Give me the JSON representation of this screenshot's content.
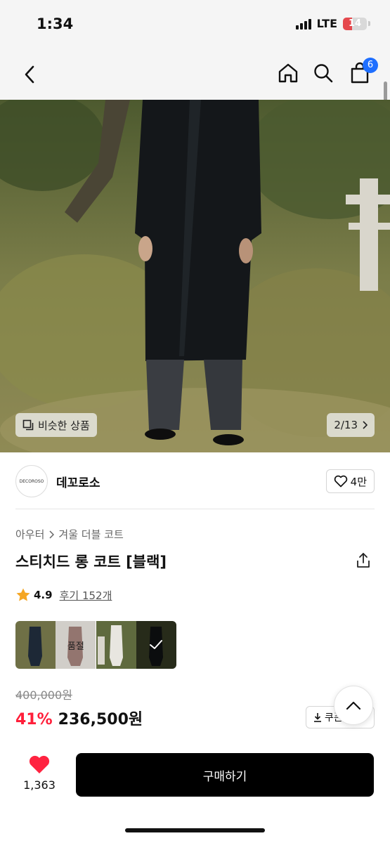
{
  "status_bar": {
    "time": "1:34",
    "network": "LTE",
    "battery": "14",
    "battery_level": 0.14
  },
  "nav": {
    "back_icon": "chevron-left-icon",
    "home_icon": "home-icon",
    "search_icon": "search-icon",
    "cart_icon": "shopping-bag-icon",
    "cart_badge": "6"
  },
  "hero": {
    "similar_label": "비슷한 상품",
    "page_indicator": "2/13"
  },
  "brand": {
    "logo_text": "DECOROSO",
    "name": "데꼬로소",
    "like_count": "4만"
  },
  "product": {
    "breadcrumb": [
      "아우터",
      "겨울 더블 코트"
    ],
    "title": "스티치드 롱 코트 [블랙]",
    "rating": "4.9",
    "reviews": "후기 152개"
  },
  "color_options": [
    {
      "name": "navy",
      "sold_out": false,
      "selected": false
    },
    {
      "name": "brown",
      "sold_out": true,
      "sold_out_label": "품절",
      "selected": false
    },
    {
      "name": "ivory",
      "sold_out": false,
      "selected": false
    },
    {
      "name": "black",
      "sold_out": false,
      "selected": true
    }
  ],
  "price": {
    "original": "400,000원",
    "discount": "41%",
    "final": "236,500원",
    "coupon_label": "쿠폰"
  },
  "bottom": {
    "wish_count": "1,363",
    "buy_label": "구매하기"
  },
  "colors": {
    "accent_blue": "#1f6fff",
    "discount_red": "#ff1f3a",
    "heart_red": "#ff2340",
    "star_yellow": "#f5a623",
    "buy_button": "#000000"
  }
}
